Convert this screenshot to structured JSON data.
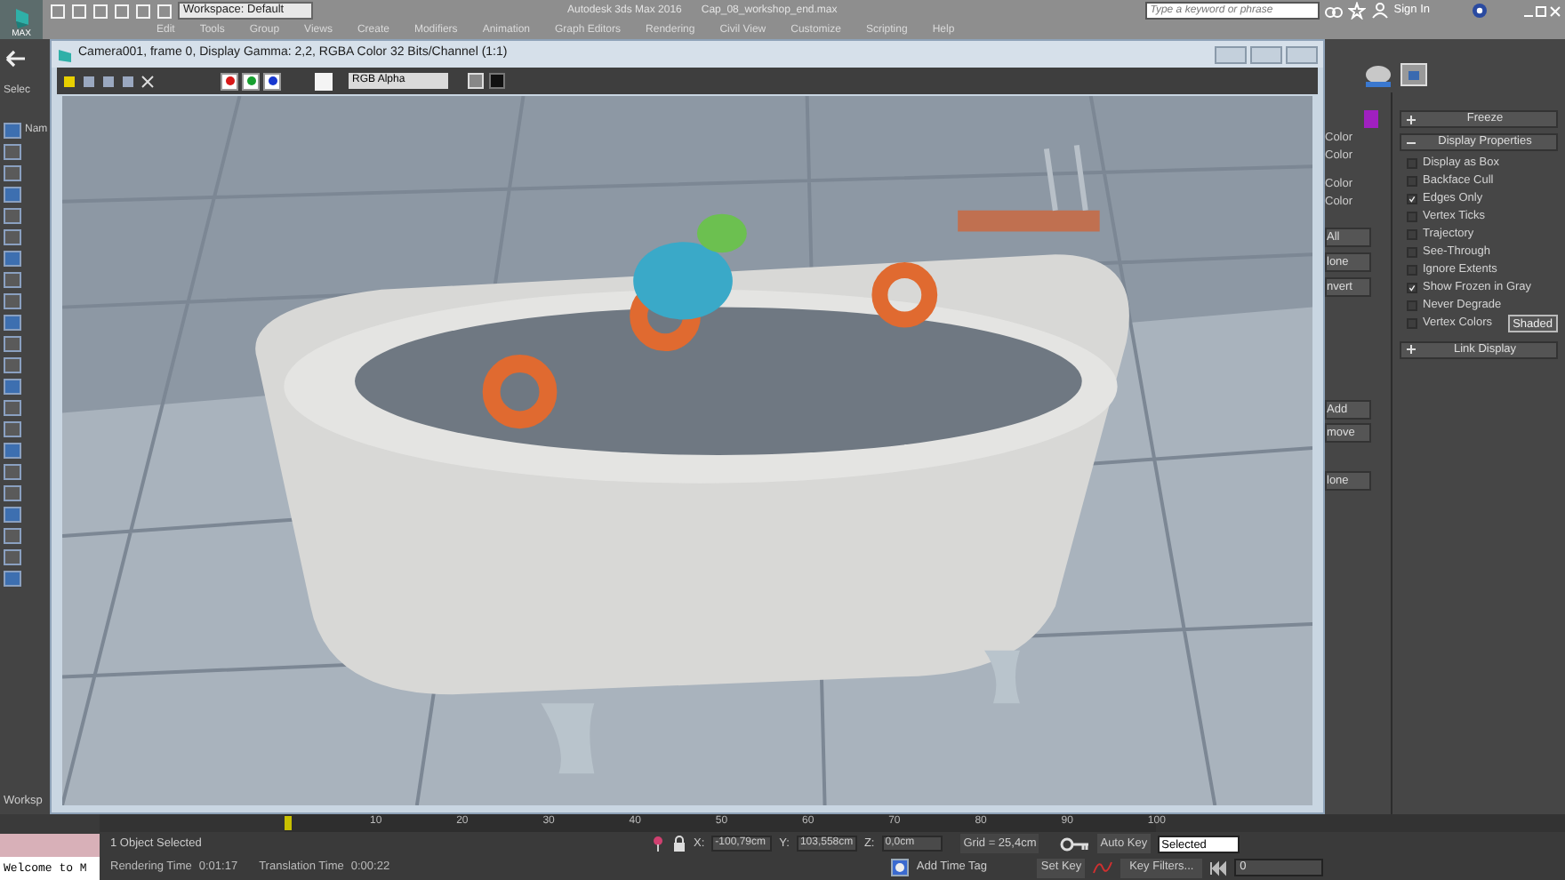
{
  "app": {
    "logo": "MAX",
    "workspace": "Workspace: Default",
    "title": "Autodesk 3ds Max 2016",
    "file": "Cap_08_workshop_end.max",
    "search": {
      "placeholder": "Type a keyword or phrase"
    },
    "sign_in": "Sign In"
  },
  "menu": [
    "Edit",
    "Tools",
    "Group",
    "Views",
    "Create",
    "Modifiers",
    "Animation",
    "Graph Editors",
    "Rendering",
    "Civil View",
    "Customize",
    "Scripting",
    "Help"
  ],
  "left_toolbar": {
    "label": "Selec",
    "name_label": "Nam",
    "workspace_label": "Worksp"
  },
  "render_window": {
    "title": "Camera001, frame 0, Display Gamma: 2,2, RGBA Color 32 Bits/Channel (1:1)",
    "channels": [
      {
        "color": "#d81818"
      },
      {
        "color": "#18a030"
      },
      {
        "color": "#1838d0"
      }
    ],
    "channel_display": "RGB Alpha"
  },
  "command_panel": {
    "partial_labels": [
      "Color",
      "Color",
      "Color",
      "Color"
    ],
    "partial_buttons": [
      "All",
      "lone",
      "nvert"
    ],
    "partial_buttons_2": [
      "Add",
      "move",
      "lone"
    ],
    "rollouts": [
      {
        "title": "Freeze",
        "expanded": false
      },
      {
        "title": "Display Properties",
        "expanded": true,
        "options": [
          {
            "label": "Display as Box",
            "checked": false
          },
          {
            "label": "Backface Cull",
            "checked": false
          },
          {
            "label": "Edges Only",
            "checked": true
          },
          {
            "label": "Vertex Ticks",
            "checked": false
          },
          {
            "label": "Trajectory",
            "checked": false
          },
          {
            "label": "See-Through",
            "checked": false
          },
          {
            "label": "Ignore Extents",
            "checked": false
          },
          {
            "label": "Show Frozen in Gray",
            "checked": true
          },
          {
            "label": "Never Degrade",
            "checked": false
          },
          {
            "label": "Vertex Colors",
            "checked": false
          }
        ],
        "button": "Shaded"
      },
      {
        "title": "Link Display",
        "expanded": false
      }
    ]
  },
  "timeline": {
    "level": 0,
    "ticks": [
      "10",
      "20",
      "30",
      "40",
      "50",
      "60",
      "70",
      "80",
      "90",
      "100"
    ]
  },
  "status_bar": {
    "listener": "Welcome to M",
    "selection": "1 Object Selected",
    "rendering_time": {
      "label": "Rendering Time",
      "value": "0:01:17"
    },
    "translation_time": {
      "label": "Translation Time",
      "value": "0:00:22"
    },
    "coords": [
      {
        "axis": "X:",
        "value": "-100,79cm"
      },
      {
        "axis": "Y:",
        "value": "103,558cm"
      },
      {
        "axis": "Z:",
        "value": "0,0cm"
      }
    ],
    "grid": "Grid = 25,4cm",
    "add_time_tag": "Add Time Tag",
    "auto_key": "Auto Key",
    "key_mode": "Selected",
    "set_key": "Set Key",
    "key_filters": "Key Filters...",
    "frame": "0"
  }
}
